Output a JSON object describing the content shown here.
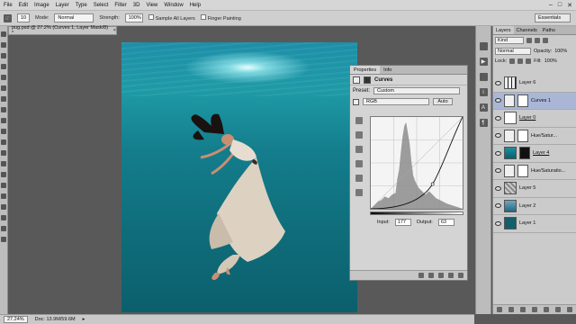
{
  "menubar": {
    "items": [
      "File",
      "Edit",
      "Image",
      "Layer",
      "Type",
      "Select",
      "Filter",
      "3D",
      "View",
      "Window",
      "Help"
    ]
  },
  "options": {
    "size": "10",
    "mode_label": "Mode:",
    "mode_value": "Normal",
    "strength_label": "Strength:",
    "strength_value": "100%",
    "sample_all_layers": "Sample All Layers",
    "finger_painting": "Finger Painting",
    "workspace": "Essentials"
  },
  "document": {
    "tab_title": "pug.psd @ 27.2% (Curves 1, Layer Mask/8) *"
  },
  "status": {
    "zoom": "27.24%",
    "doc": "Doc: 13.9M/59.6M"
  },
  "properties": {
    "tabs": [
      "Properties",
      "Info"
    ],
    "title": "Curves",
    "preset_label": "Preset:",
    "preset_value": "Custom",
    "channel": "RGB",
    "auto": "Auto",
    "input_label": "Input:",
    "input_value": "177",
    "output_label": "Output:",
    "output_value": "63"
  },
  "layers": {
    "tabs": [
      "Layers",
      "Channels",
      "Paths"
    ],
    "kind": "Kind",
    "blend": "Normal",
    "opacity_label": "Opacity:",
    "opacity_value": "100%",
    "lock_label": "Lock:",
    "fill_label": "Fill:",
    "fill_value": "100%",
    "items": [
      {
        "name": "Layer 6",
        "type": "pixel"
      },
      {
        "name": "Curves 1",
        "type": "adjustment",
        "selected": true
      },
      {
        "name": "Layer 0",
        "type": "pixel"
      },
      {
        "name": "Hue/Satur...",
        "type": "adjustment"
      },
      {
        "name": "Layer 4",
        "type": "pixel"
      },
      {
        "name": "Hue/Saturatio...",
        "type": "adjustment"
      },
      {
        "name": "Layer 5",
        "type": "pixel"
      },
      {
        "name": "Layer 2",
        "type": "pixel"
      },
      {
        "name": "Layer 1",
        "type": "pixel"
      }
    ]
  },
  "colors": {
    "accent_selected": "#a9b6d6",
    "water_light": "#1d8fa8",
    "water_dark": "#0c5f6d"
  }
}
